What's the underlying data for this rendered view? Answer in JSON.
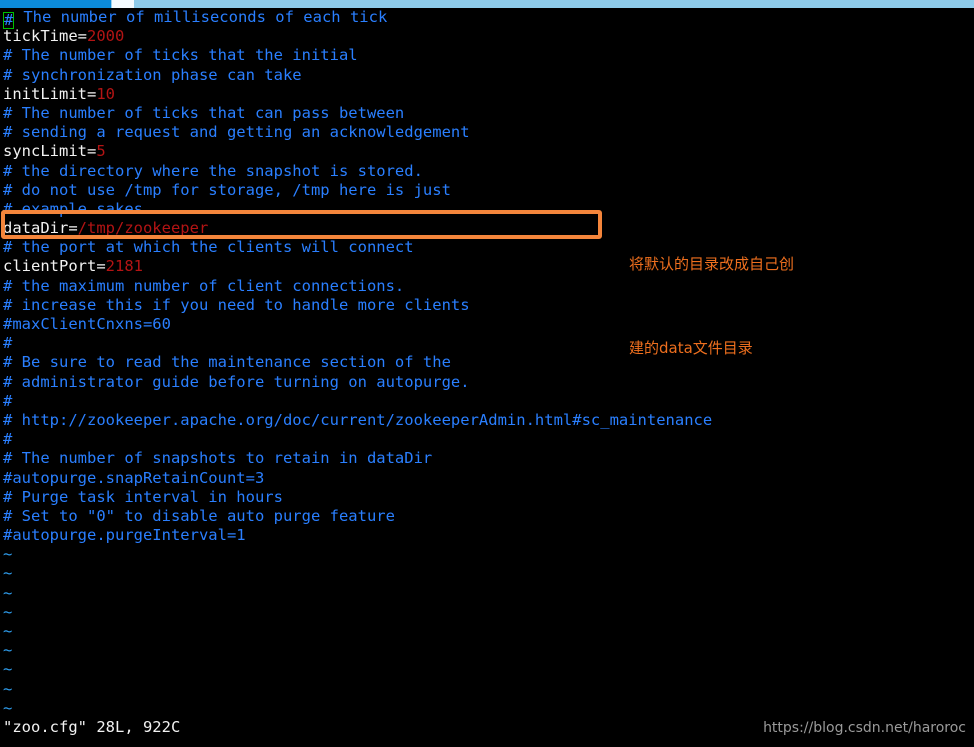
{
  "window": {
    "title": "zoo.cfg",
    "scrollbar": {
      "name": "horizontal-scrollbar",
      "filled_color": "#0c8bd9",
      "thumb_color": "#f4fbff",
      "track_color": "#8ecbea"
    }
  },
  "editor": {
    "cursor_char": "#",
    "cursor_color": "#00c000",
    "background": "#000000",
    "comment_color": "#2a7fff",
    "key_color": "#f2f2f2",
    "value_color": "#b31414",
    "tilde_color": "#2f9ff0",
    "lines": [
      {
        "type": "cursor-comment",
        "cursor": "#",
        "text": " The number of milliseconds of each tick"
      },
      {
        "type": "setting",
        "key": "tickTime=",
        "value": "2000"
      },
      {
        "type": "comment",
        "text": "# The number of ticks that the initial"
      },
      {
        "type": "comment",
        "text": "# synchronization phase can take"
      },
      {
        "type": "setting",
        "key": "initLimit=",
        "value": "10"
      },
      {
        "type": "comment",
        "text": "# The number of ticks that can pass between"
      },
      {
        "type": "comment",
        "text": "# sending a request and getting an acknowledgement"
      },
      {
        "type": "setting",
        "key": "syncLimit=",
        "value": "5"
      },
      {
        "type": "comment",
        "text": "# the directory where the snapshot is stored."
      },
      {
        "type": "comment",
        "text": "# do not use /tmp for storage, /tmp here is just"
      },
      {
        "type": "comment",
        "text": "# example sakes"
      },
      {
        "type": "setting",
        "key": "dataDir=",
        "value": "/tmp/zookeeper"
      },
      {
        "type": "comment",
        "text": "# the port at which the clients will connect"
      },
      {
        "type": "setting",
        "key": "clientPort=",
        "value": "2181"
      },
      {
        "type": "comment",
        "text": "# the maximum number of client connections."
      },
      {
        "type": "comment",
        "text": "# increase this if you need to handle more clients"
      },
      {
        "type": "comment",
        "text": "#maxClientCnxns=60"
      },
      {
        "type": "comment",
        "text": "#"
      },
      {
        "type": "comment",
        "text": "# Be sure to read the maintenance section of the"
      },
      {
        "type": "comment",
        "text": "# administrator guide before turning on autopurge."
      },
      {
        "type": "comment",
        "text": "#"
      },
      {
        "type": "comment",
        "text": "# http://zookeeper.apache.org/doc/current/zookeeperAdmin.html#sc_maintenance"
      },
      {
        "type": "comment",
        "text": "#"
      },
      {
        "type": "comment",
        "text": "# The number of snapshots to retain in dataDir"
      },
      {
        "type": "comment",
        "text": "#autopurge.snapRetainCount=3"
      },
      {
        "type": "comment",
        "text": "# Purge task interval in hours"
      },
      {
        "type": "comment",
        "text": "# Set to \"0\" to disable auto purge feature"
      },
      {
        "type": "comment",
        "text": "#autopurge.purgeInterval=1"
      },
      {
        "type": "tilde",
        "text": "~"
      },
      {
        "type": "tilde",
        "text": "~"
      },
      {
        "type": "tilde",
        "text": "~"
      },
      {
        "type": "tilde",
        "text": "~"
      },
      {
        "type": "tilde",
        "text": "~"
      },
      {
        "type": "tilde",
        "text": "~"
      },
      {
        "type": "tilde",
        "text": "~"
      },
      {
        "type": "tilde",
        "text": "~"
      },
      {
        "type": "tilde",
        "text": "~"
      }
    ]
  },
  "annotation": {
    "line1": "将默认的目录改成自己创",
    "line2": "建的data文件目录",
    "color": "#ee6f1e",
    "highlight_box_color": "#f4853b"
  },
  "status": {
    "text": "\"zoo.cfg\" 28L, 922C",
    "watermark": "https://blog.csdn.net/haroroc"
  }
}
